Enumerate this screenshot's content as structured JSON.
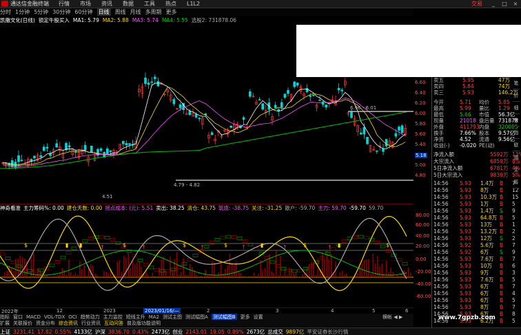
{
  "window": {
    "app_title": "通达信金融终端",
    "menus": [
      "行情",
      "市场",
      "资讯",
      "数据",
      "工具",
      "热点",
      "L1L2"
    ],
    "trade_label": "交易",
    "controls": [
      "_",
      "□",
      "×"
    ]
  },
  "periods": [
    "分时",
    "1分钟",
    "5分钟",
    "30分钟",
    "60分钟",
    "日线",
    "周线",
    "月线",
    "多周期",
    "更多"
  ],
  "selected_period": "日线",
  "ma_bar": {
    "stock": "凯撒文化(日线)",
    "signal": "锁定牛股买入",
    "ma1": "MA1: 5.79",
    "ma2": "MA2: 5.88",
    "ma3": "MA3: 5.74",
    "ma4": "MA4: 5.55",
    "extra": "选股2: 731878.06"
  },
  "price_axis": [
    "6.60",
    "6.40",
    "6.20",
    "6.00",
    "5.80",
    "5.60",
    "5.40",
    "5.20",
    "5.00",
    "4.80"
  ],
  "chart_annotations": {
    "high_label": "6.96 - 6.01",
    "low_label": "4.79 - 4.82",
    "low_left": "4.51",
    "price_tag": "5.18"
  },
  "indicator_bar": {
    "name": "神奇看准",
    "a": "主力筹码%: 0.00",
    "b": "建仓天数: 0.00",
    "c": "拐点成本: (元): 5.51",
    "d": "卖出: 38.25",
    "e": "清仓: 43.75",
    "f": "筑底: -38.75",
    "g": "关注: -31.25",
    "h": "散户: -59.70",
    "i": "主力: 59.70",
    "j": "-59.70",
    "k": "59.70"
  },
  "indicator_axis": [
    "80.00",
    "60.00",
    "40.00",
    "20.00",
    "0.00",
    "-20.00",
    "-40.00",
    "-60.00"
  ],
  "indicator_markers": [
    "减",
    "B",
    "强",
    "涨"
  ],
  "time_axis": {
    "year_label": "2022年",
    "highlight": "2023/01/16/—",
    "ticks": [
      "12",
      "2023",
      "2",
      "3",
      "4",
      "5",
      "6"
    ]
  },
  "tabs1": [
    "指标",
    "窗口",
    "MACD",
    "VOL-TDX",
    "OCI",
    "趋势动力",
    "主力监控",
    "短线主升",
    "MA2",
    "测试主图",
    "测试幅图A",
    "测试幅图B",
    "更多",
    "设置"
  ],
  "tabs1_active": "测试幅图B",
  "scroll_label": "横帐",
  "tabs2": [
    "扩展",
    "关联报价",
    "资金分布",
    "综合资讯",
    "行业资讯",
    "互动问答",
    "普及版功能说明"
  ],
  "quotes": [
    {
      "label": "卖五",
      "price": "5.95",
      "vol": "47万"
    },
    {
      "label": "卖四",
      "price": "5.84",
      "vol": "74万"
    },
    {
      "label": "卖三",
      "price": "5.93",
      "vol": "146.2万"
    }
  ],
  "stats": [
    {
      "l1": "今开",
      "v1": "5.71",
      "l2": "均价",
      "v2": "5.85",
      "c1": "red",
      "c2": "red"
    },
    {
      "l1": "最高",
      "v1": "5.99",
      "l2": "量比",
      "v2": "1.29",
      "c1": "red",
      "c2": "red"
    },
    {
      "l1": "最低",
      "v1": "5.66",
      "l2": "市值",
      "v2": "56.3亿",
      "c1": "green",
      "c2": "white"
    },
    {
      "l1": "现量",
      "v1": "21018",
      "l2": "盘后量",
      "v2": "731878",
      "c1": "magenta",
      "c2": "white"
    },
    {
      "l1": "外盘",
      "v1": "411793",
      "l2": "内盘",
      "v2": "320085",
      "c1": "red",
      "c2": "green"
    },
    {
      "l1": "换手",
      "v1": "7.66%",
      "l2": "股本",
      "v2": "9.57亿",
      "c1": "white",
      "c2": "white"
    },
    {
      "l1": "净资",
      "v1": "4.52",
      "l2": "流通",
      "v2": "9.56亿",
      "c1": "white",
      "c2": "white"
    },
    {
      "l1": "收益(-)",
      "v1": "-0.020",
      "l2": "PE(动)",
      "v2": "",
      "c1": "white",
      "c2": "white"
    }
  ],
  "flows": [
    {
      "label": "净流入额",
      "val": "5592万",
      "pct": "13%"
    },
    {
      "label": "大宗流入",
      "val": "6859万",
      "pct": "8%"
    },
    {
      "label": "5日净流入额",
      "val": "6781万",
      "pct": "4%"
    },
    {
      "label": "5日大宗流入",
      "val": "9839万",
      "pct": "5%"
    }
  ],
  "ticks": [
    {
      "t": "14:56",
      "p": "5.93",
      "v": "1.4万",
      "d": "B",
      "n": "7"
    },
    {
      "t": "14:56",
      "p": "5.93",
      "v": "8万",
      "d": "B",
      "n": "12"
    },
    {
      "t": "14:56",
      "p": "5.93",
      "v": "10.3万",
      "d": "B",
      "n": "15"
    },
    {
      "t": "14:56",
      "p": "5.93",
      "v": "1万",
      "d": "B",
      "n": "5"
    },
    {
      "t": "14:56",
      "p": "5.93",
      "v": "1.4万",
      "d": "S",
      "n": "9"
    },
    {
      "t": "14:56",
      "p": "5.93",
      "v": "64.8万",
      "d": "B",
      "n": "5"
    },
    {
      "t": "14:56",
      "p": "5.93",
      "v": "13万",
      "d": "B",
      "n": "1"
    },
    {
      "t": "14:56",
      "p": "5.93",
      "v": "13.2万",
      "d": "B",
      "n": "2"
    },
    {
      "t": "14:56",
      "p": "5.93",
      "v": "12万",
      "d": "S",
      "n": "2"
    },
    {
      "t": "14:56",
      "p": "5.92",
      "v": "5.6万",
      "d": "B",
      "n": "7"
    },
    {
      "t": "14:56",
      "p": "5.92",
      "v": "6万",
      "d": "S",
      "n": "9"
    },
    {
      "t": "14:56",
      "p": "5.93",
      "v": "7.6万",
      "d": "B",
      "n": "7"
    },
    {
      "t": "14:56",
      "p": "5.93",
      "v": "10万",
      "d": "B",
      "n": "6"
    },
    {
      "t": "14:56",
      "p": "5.93",
      "v": "9万",
      "d": "B",
      "n": "3"
    },
    {
      "t": "14:56",
      "p": "5.93",
      "v": "7.6万",
      "d": "B",
      "n": "5"
    },
    {
      "t": "14:56",
      "p": "5.93",
      "v": "6万",
      "d": "B",
      "n": "7"
    },
    {
      "t": "14:56",
      "p": "5.93",
      "v": "6万",
      "d": "B",
      "n": "4"
    },
    {
      "t": "14:56",
      "p": "5.93",
      "v": "6万",
      "d": "B",
      "n": "5"
    },
    {
      "t": "14:56",
      "p": "5.93",
      "v": "8万",
      "d": "B",
      "n": "7"
    },
    {
      "t": "14:56",
      "p": "5.93",
      "v": "6万",
      "d": "B",
      "n": "8"
    },
    {
      "t": "14:56",
      "p": "5.93",
      "v": "6.2万",
      "d": "B",
      "n": "5"
    }
  ],
  "right_tabs": [
    "笔",
    "价",
    "细",
    "势",
    "指",
    "联",
    "值",
    "主",
    "筹"
  ],
  "status": {
    "sh_name": "上证",
    "sh_val": "3231.41",
    "sh_chg": "17.82",
    "sh_pct": "0.55%",
    "sh_amt": "4133亿",
    "sz_name": "沪深",
    "sz_val": "3836.70",
    "sz_pct": "0.43%",
    "sz_amt": "2473亿",
    "cy_name": "创业",
    "cy_val": "2143.01",
    "cy_chg": "19.05",
    "cy_pct": "0.89%",
    "cy_amt": "2673亿",
    "total_name": "总成交",
    "total_val": "9897亿",
    "extra": "平安证券长沙行情"
  },
  "watermark": "www.7gpzb.com",
  "colors": {
    "up": "#ff3b3b",
    "down": "#00d000",
    "yellow": "#ffd800",
    "white": "#ffffff",
    "cyan": "#00d8d8",
    "magenta": "#ff50ff",
    "accent": "#0033aa"
  }
}
